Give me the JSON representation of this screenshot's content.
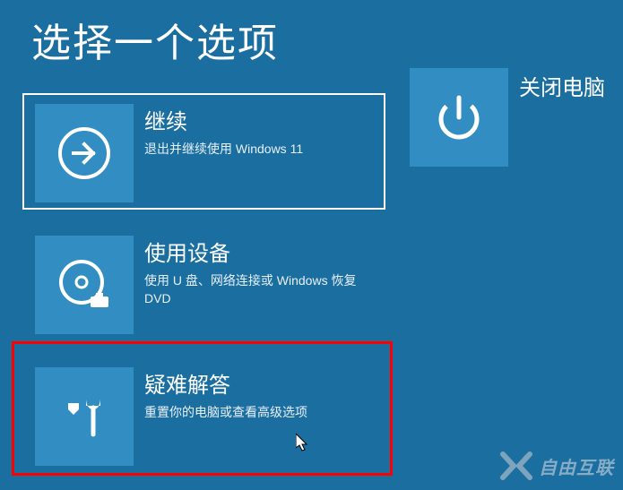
{
  "title": "选择一个选项",
  "options": {
    "continue": {
      "title": "继续",
      "desc": "退出并继续使用 Windows 11",
      "icon": "arrow-right"
    },
    "use_device": {
      "title": "使用设备",
      "desc": "使用 U 盘、网络连接或 Windows 恢复 DVD",
      "icon": "disc"
    },
    "troubleshoot": {
      "title": "疑难解答",
      "desc": "重置你的电脑或查看高级选项",
      "icon": "tools"
    },
    "shutdown": {
      "title": "关闭电脑",
      "icon": "power"
    }
  },
  "watermark": "自由互联",
  "colors": {
    "background": "#1a6ea0",
    "tile_bg": "#328dc2",
    "highlight": "#ff0000"
  }
}
